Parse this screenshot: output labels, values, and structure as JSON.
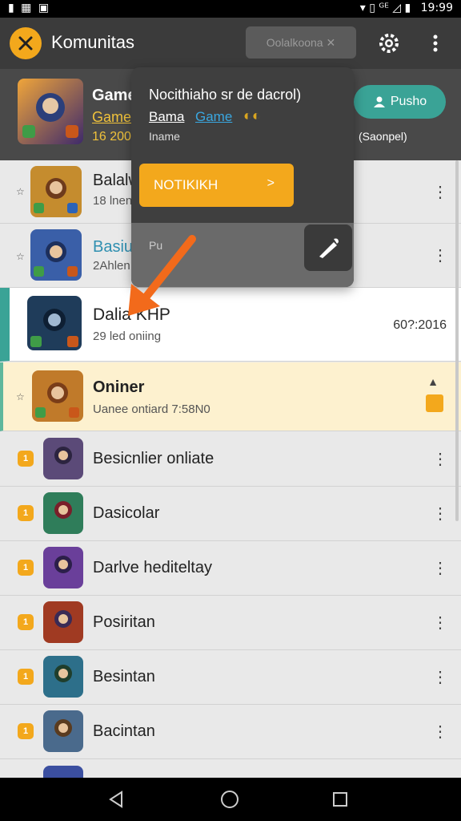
{
  "status_bar": {
    "left_icons": "▮ ▦ ▣",
    "time": "19:99",
    "indicators": "▾ ▯ ᴳᴱ ◿ ▮"
  },
  "app_bar": {
    "title": "Komunitas",
    "search_chip": "Oolalkoona ✕"
  },
  "header_card": {
    "title": "Game",
    "subtitle": "Game",
    "meta": "16 200",
    "follow_label": "Pusho",
    "online_label": "(Saonpel)"
  },
  "popup": {
    "title": "Nocithiaho sr de dacrol)",
    "link1": "Bama",
    "link2": "Game",
    "gold_icons": "◐◐",
    "small": "Iname",
    "button_label": "NOTIKIKH",
    "button_chevron": ">",
    "footer_text": "Pu"
  },
  "rows": [
    {
      "title": "Balalw",
      "subtitle": "18 lnen"
    },
    {
      "title": "Basiu",
      "subtitle": "2Ahlen",
      "title_color": "#2f8fb0"
    },
    {
      "title": "Dalia KHP",
      "subtitle": "29 led oniing",
      "date": "60?:2016"
    },
    {
      "title": "Oniner",
      "subtitle": "Uanee ontiard 7:58N0"
    },
    {
      "title": "Besicnlier onliate"
    },
    {
      "title": "Dasicolar"
    },
    {
      "title": "Darlve hediteltay"
    },
    {
      "title": "Posiritan"
    },
    {
      "title": "Besintan"
    },
    {
      "title": "Bacintan"
    }
  ],
  "colors": {
    "accent_orange": "#f3a81c",
    "teal": "#3aa396",
    "popup_bg": "#3f3f3f",
    "highlight_bg": "#fdf1cf"
  },
  "icons": [
    "logo-icon",
    "settings-icon",
    "more-icon",
    "edit-icon",
    "arrow-annotation-icon",
    "star-icon",
    "back-icon",
    "home-icon",
    "recents-icon"
  ]
}
